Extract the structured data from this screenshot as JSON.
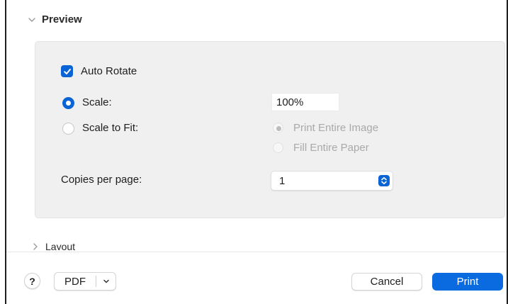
{
  "preview_section": {
    "title": "Preview",
    "expanded": true,
    "auto_rotate": {
      "label": "Auto Rotate",
      "checked": true
    },
    "scale": {
      "label": "Scale:",
      "selected": true,
      "value": "100%"
    },
    "scale_to_fit": {
      "label": "Scale to Fit:",
      "selected": false,
      "options": [
        {
          "label": "Print Entire Image",
          "selected": true,
          "enabled": false
        },
        {
          "label": "Fill Entire Paper",
          "selected": false,
          "enabled": false
        }
      ]
    },
    "copies_per_page": {
      "label": "Copies per page:",
      "value": "1"
    }
  },
  "layout_section": {
    "title": "Layout",
    "expanded": false
  },
  "footer": {
    "help_label": "?",
    "pdf_label": "PDF",
    "cancel_label": "Cancel",
    "print_label": "Print"
  },
  "colors": {
    "accent": "#0a64d6",
    "panel_bg": "#f0f0f0",
    "disabled_text": "#a9a9a9"
  },
  "icons": [
    "chevron-down-icon",
    "chevron-right-icon",
    "checkmark-icon",
    "stepper-icon",
    "pdf-menu-chevron-icon"
  ]
}
